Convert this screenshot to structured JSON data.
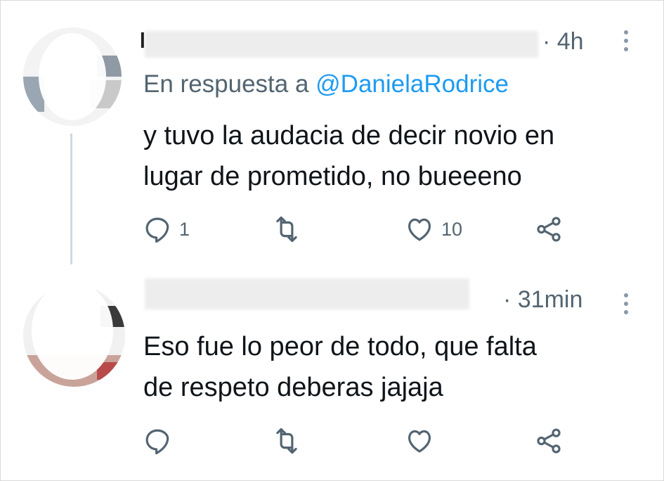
{
  "tweets": [
    {
      "time": "· 4h",
      "reply_to_prefix": "En respuesta a ",
      "reply_to_handle": "@DanielaRodrice",
      "text_line1": "y tuvo la audacia de decir novio en",
      "text_line2": "lugar de prometido, no bueeeno",
      "reply_count": "1",
      "retweet_count": "",
      "like_count": "10"
    },
    {
      "time": "· 31min",
      "text_line1": "Eso fue lo peor de todo, que falta",
      "text_line2": "de respeto deberas jajaja",
      "reply_count": "",
      "retweet_count": "",
      "like_count": ""
    }
  ],
  "icons": {
    "reply": "reply-icon",
    "retweet": "retweet-icon",
    "like": "heart-icon",
    "share": "share-icon",
    "more": "more-options-icon"
  },
  "colors": {
    "secondary_text": "#536471",
    "mention": "#1d9bf0",
    "primary_text": "#0f1419"
  }
}
